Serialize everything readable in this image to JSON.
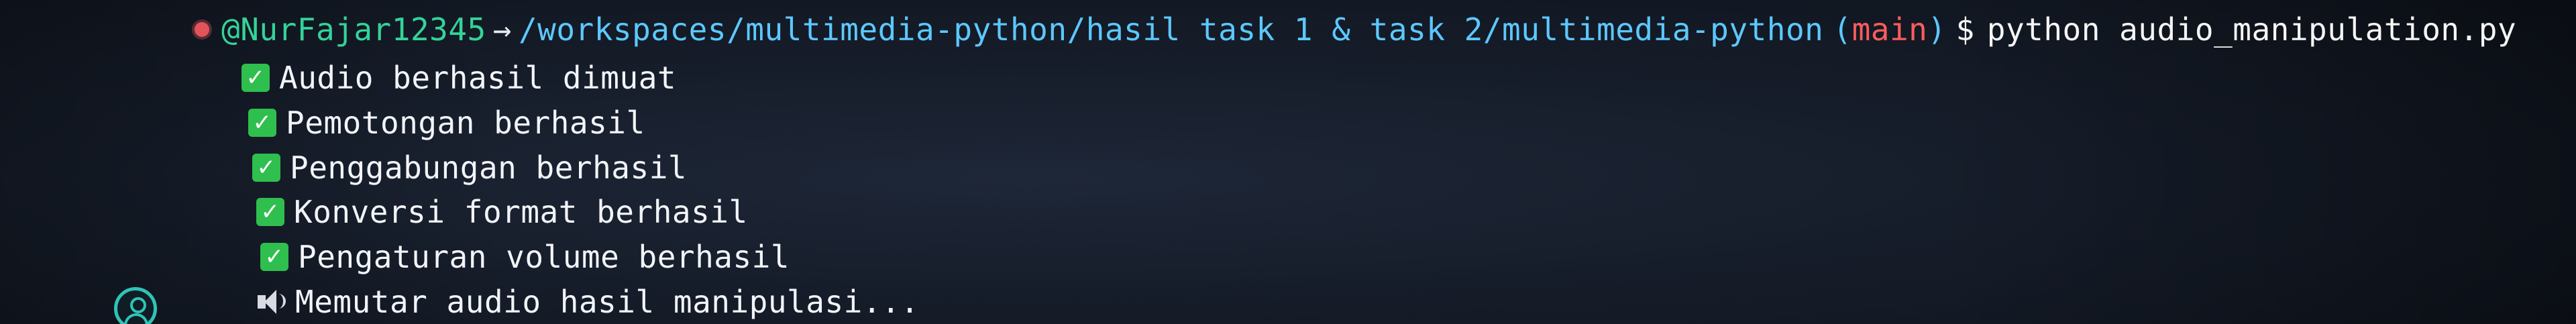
{
  "prompt": {
    "user": "@NurFajar12345",
    "arrow": "→",
    "path": "/workspaces/multimedia-python/hasil task 1 & task 2/multimedia-python",
    "paren_open": "(",
    "branch": "main",
    "paren_close": ")",
    "dollar": "$",
    "command": "python audio_manipulation.py"
  },
  "output": [
    "Audio berhasil dimuat",
    "Pemotongan berhasil",
    "Penggabungan berhasil",
    "Konversi format berhasil",
    "Pengaturan volume berhasil"
  ],
  "playing": "Memutar audio hasil manipulasi...",
  "icons": {
    "check": "check-mark-icon",
    "speaker": "speaker-icon",
    "account": "account-icon"
  },
  "colors": {
    "user": "#34d399",
    "path": "#5cc8ff",
    "branch": "#ff5c5c",
    "check_bg": "#2fbf4e",
    "status_dot": "#e2545a"
  }
}
